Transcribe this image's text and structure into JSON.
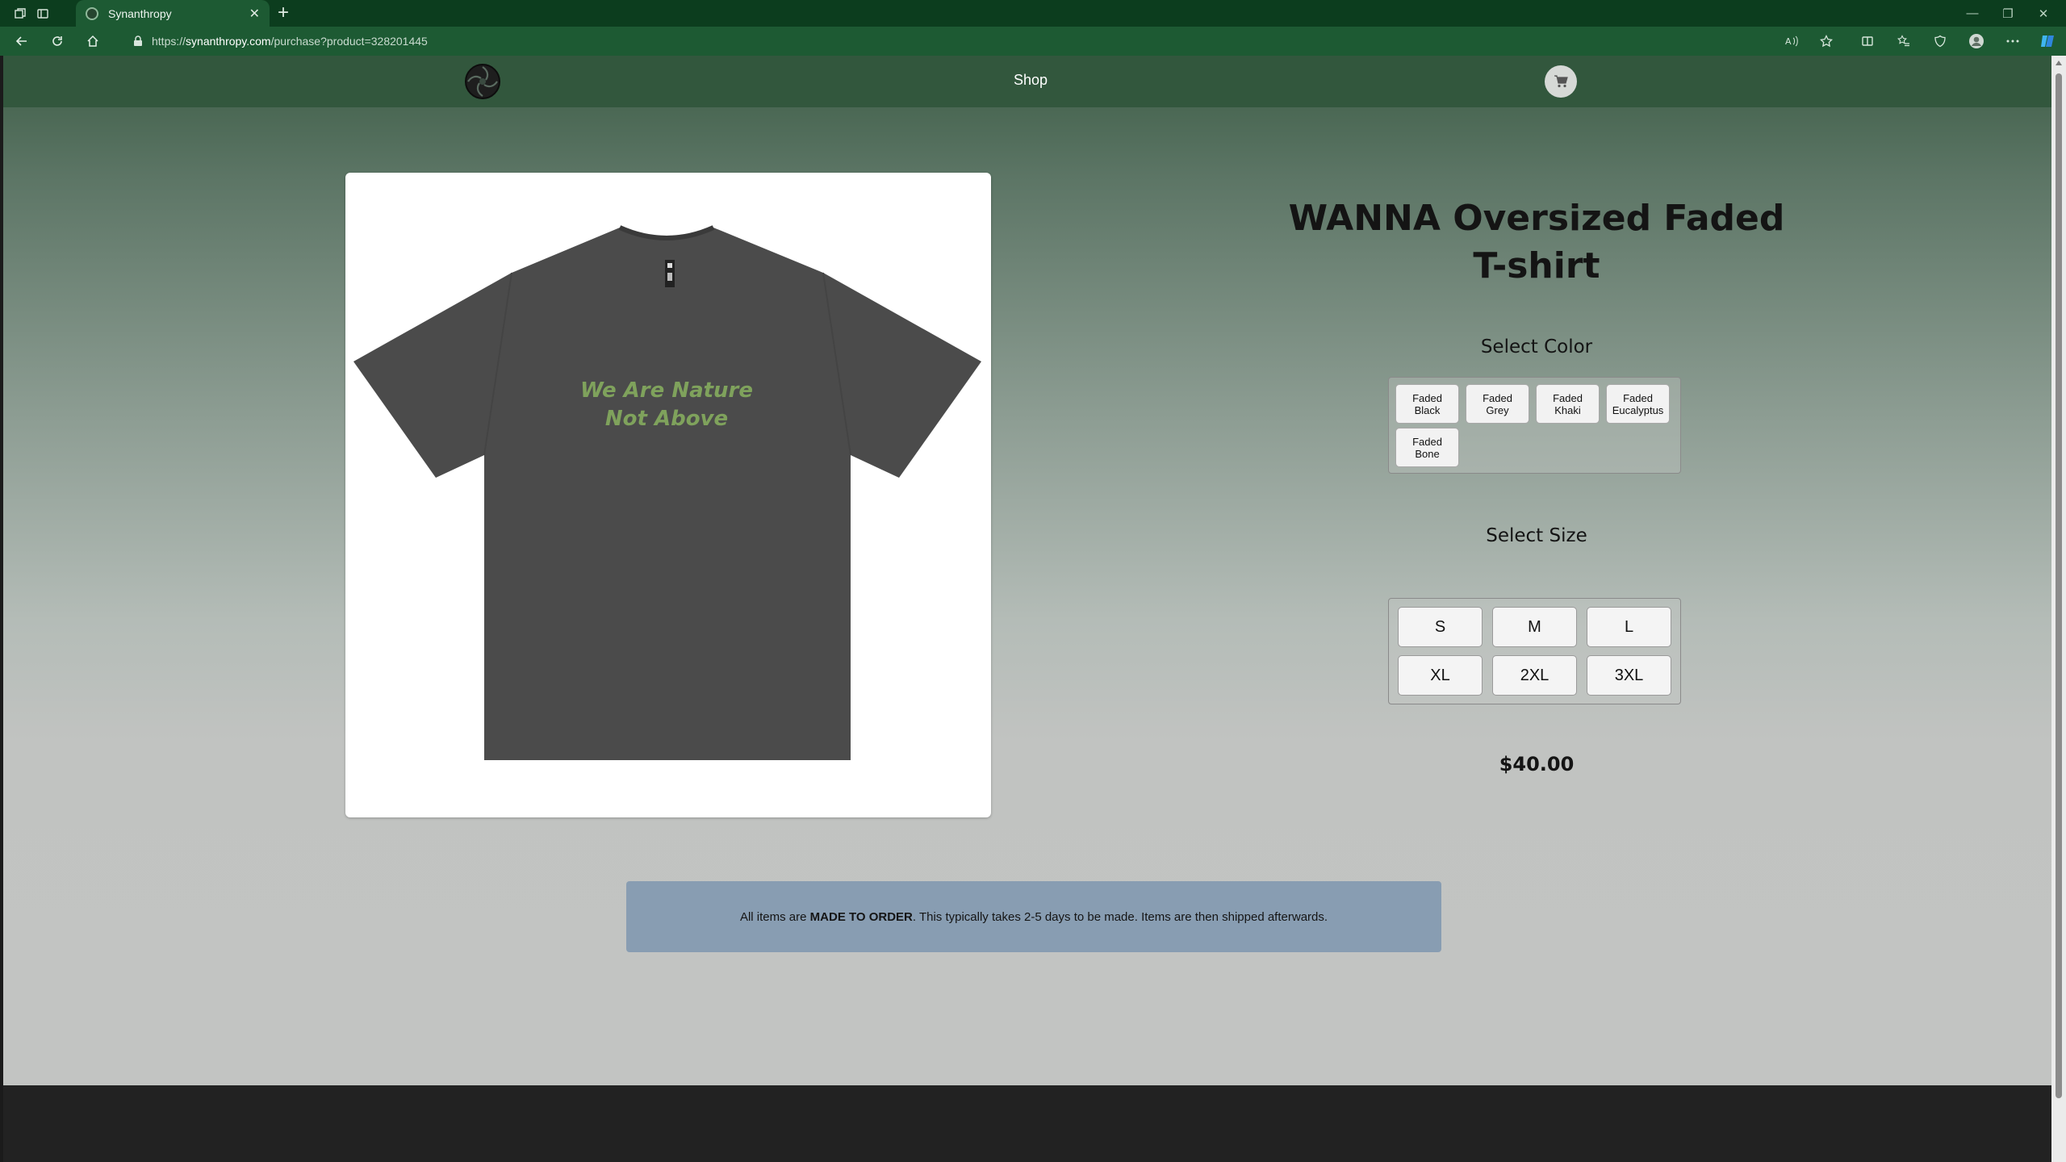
{
  "browser": {
    "tab_title": "Synanthropy",
    "tab_close": "✕",
    "new_tab": "+",
    "url_scheme": "https://",
    "url_host": "synanthropy.com",
    "url_path": "/purchase?product=328201445",
    "window_controls": {
      "minimize": "—",
      "restore": "❐",
      "close": "✕"
    }
  },
  "site": {
    "nav_shop": "Shop"
  },
  "product": {
    "title_line1": "WANNA Oversized Faded",
    "title_line2": "T-shirt",
    "image_text_line1": "We Are Nature",
    "image_text_line2": "Not Above",
    "select_color_label": "Select Color",
    "colors": [
      {
        "line1": "Faded",
        "line2": "Black"
      },
      {
        "line1": "Faded",
        "line2": "Grey"
      },
      {
        "line1": "Faded",
        "line2": "Khaki"
      },
      {
        "line1": "Faded",
        "line2": "Eucalyptus"
      },
      {
        "line1": "Faded",
        "line2": "Bone"
      }
    ],
    "select_size_label": "Select Size",
    "sizes": [
      "S",
      "M",
      "L",
      "XL",
      "2XL",
      "3XL"
    ],
    "price": "$40.00"
  },
  "notice": {
    "prefix": "All items are ",
    "emphasis": "MADE TO ORDER",
    "suffix": ". This typically takes 2-5 days to be made. Items are then shipped afterwards."
  },
  "colors": {
    "tabbar_bg": "#0c3d1e",
    "toolbar_bg": "#1d5a33",
    "site_header_bg": "#32573d",
    "notice_bg": "#889db2",
    "footer_bg": "#222222",
    "shirt": "#4a4a4a",
    "shirt_print": "#7fa25c"
  }
}
